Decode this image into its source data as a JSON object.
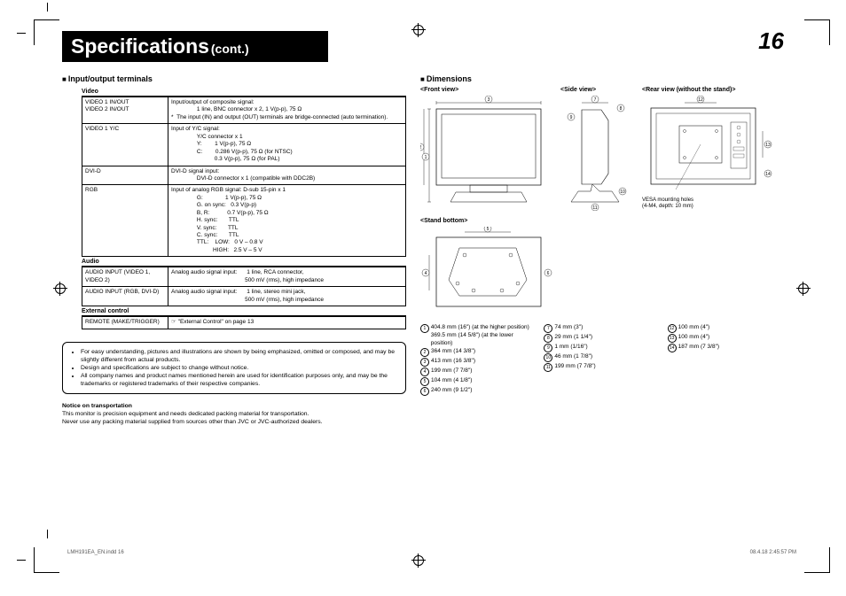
{
  "header": {
    "title_main": "Specifications",
    "title_sub": "(cont.)",
    "page_num": "16"
  },
  "sections": {
    "io": {
      "title": "Input/output terminals",
      "video": {
        "head": "Video",
        "r1": {
          "c1a": "VIDEO 1 IN/OUT",
          "c1b": "VIDEO 2 IN/OUT",
          "c2": "Input/output of composite signal:\n                1 line, BNC connector x 2, 1 V(p-p), 75 Ω\n*  The input (IN) and output (OUT) terminals are bridge-connected (auto termination)."
        },
        "r2": {
          "c1": "VIDEO 1 Y/C",
          "c2": "Input of Y/C signal:\n                Y/C connector x 1\n                Y:        1 V(p-p), 75 Ω\n                C:        0.286 V(p-p), 75 Ω (for NTSC)\n                           0.3 V(p-p), 75 Ω (for PAL)"
        },
        "r3": {
          "c1": "DVI-D",
          "c2": "DVI-D signal input:\n                DVI-D connector x 1 (compatible with DDC2B)"
        },
        "r4": {
          "c1": "RGB",
          "c2": "Input of analog RGB signal: D-sub 15-pin x 1\n                G:              1 V(p-p), 75 Ω\n                G. on sync:   0.3 V(p-p)\n                B, R:           0.7 V(p-p), 75 Ω\n                H. sync:       TTL\n                V. sync:       TTL\n                C. sync:       TTL\n                TTL:    LOW:   0 V – 0.8 V\n                          HIGH:   2.5 V – 5 V"
        }
      },
      "audio": {
        "head": "Audio",
        "r1": {
          "c1": "AUDIO INPUT (VIDEO 1, VIDEO 2)",
          "c2": "Analog audio signal input:      1 line, RCA connector,\n                                              500 mV (rms), high impedance"
        },
        "r2": {
          "c1": "AUDIO INPUT (RGB, DVI-D)",
          "c2": "Analog audio signal input:      1 line, stereo mini jack,\n                                              500 mV (rms), high impedance"
        }
      },
      "ext": {
        "head": "External control",
        "r1": {
          "c1": "REMOTE (MAKE/TRIGGER)",
          "c2": "☞ \"External Control\" on page 13"
        }
      }
    },
    "notes": {
      "b1": "For easy understanding, pictures and illustrations are shown by being emphasized, omitted or composed, and may be slightly different from actual products.",
      "b2": "Design and specifications are subject to change without notice.",
      "b3": "All company names and product names mentioned herein are used for identification purposes only, and may be the trademarks or registered trademarks of their respective companies."
    },
    "transport": {
      "head": "Notice on transportation",
      "l1": "This monitor is precision equipment and needs dedicated packing material for transportation.",
      "l2": "Never use any packing material supplied from sources other than JVC or JVC-authorized dealers."
    },
    "dims": {
      "title": "Dimensions",
      "views": {
        "front": "<Front view>",
        "side": "<Side view>",
        "rear": "<Rear view (without the stand)>",
        "stand": "<Stand bottom>"
      },
      "vesa": {
        "l1": "VESA mounting holes",
        "l2": "(4-M4, depth: 10 mm)"
      },
      "list": [
        {
          "n": "1",
          "t": "404.8 mm (16\") (at the higher position)\n369.5 mm (14 5/8\") (at the lower position)"
        },
        {
          "n": "2",
          "t": "364 mm (14 3/8\")"
        },
        {
          "n": "3",
          "t": "413 mm (16 3/8\")"
        },
        {
          "n": "4",
          "t": "199 mm (7 7/8\")"
        },
        {
          "n": "5",
          "t": "104 mm (4 1/8\")"
        },
        {
          "n": "6",
          "t": "240 mm (9 1/2\")"
        },
        {
          "n": "7",
          "t": "74 mm (3\")"
        },
        {
          "n": "8",
          "t": "29 mm (1 1/4\")"
        },
        {
          "n": "9",
          "t": "1 mm (1/16\")"
        },
        {
          "n": "10",
          "t": "46 mm (1 7/8\")"
        },
        {
          "n": "11",
          "t": "199 mm (7 7/8\")"
        },
        {
          "n": "12",
          "t": "100 mm (4\")"
        },
        {
          "n": "13",
          "t": "100 mm (4\")"
        },
        {
          "n": "14",
          "t": "187 mm (7 3/8\")"
        }
      ]
    }
  },
  "footer": {
    "left": "LMH191EA_EN.indd   16",
    "right": "08.4.18   2:45:57 PM"
  }
}
